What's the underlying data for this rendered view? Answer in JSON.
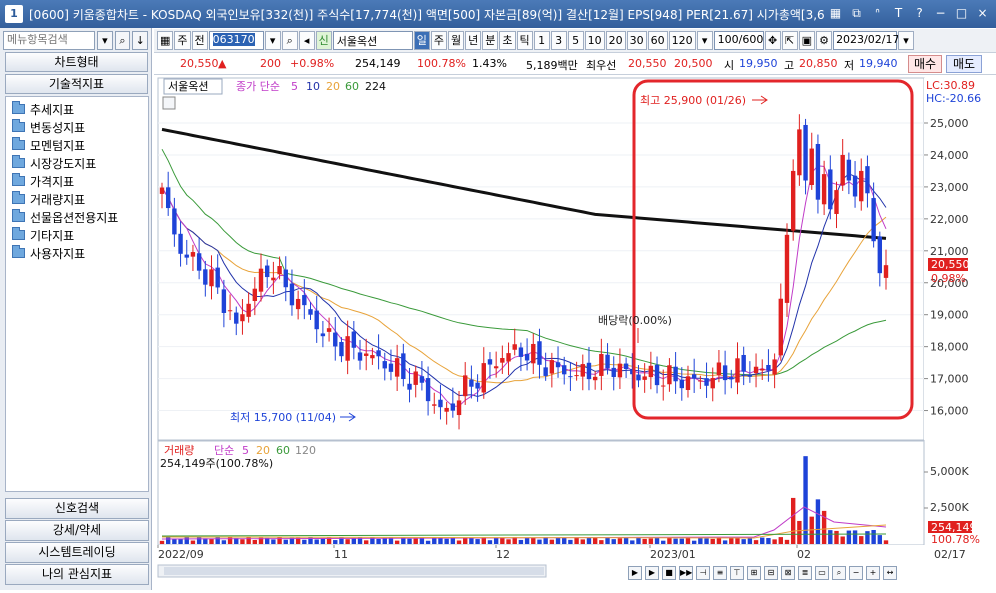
{
  "window": {
    "title": "[0600] 키움종합차트 - KOSDAQ 외국인보유[332(천)] 주식수[17,774(천)] 액면[500] 자본금[89(억)] 결산[12월] EPS[948] PER[21.67] 시가총액[3,6",
    "icon": "1"
  },
  "left": {
    "search_placeholder": "메뉴항목검색",
    "chart_type": "차트형태",
    "indicators_title": "기술적지표",
    "tree": [
      "추세지표",
      "변동성지표",
      "모멘텀지표",
      "시장강도지표",
      "가격지표",
      "거래량지표",
      "선물옵션전용지표",
      "기타지표",
      "사용자지표"
    ],
    "bottom": [
      "신호검색",
      "강세/약세",
      "시스템트레이딩",
      "나의 관심지표"
    ]
  },
  "toolbar": {
    "code": "063170",
    "stock_name": "서울옥션",
    "stock_badge": "신",
    "periods": [
      "일",
      "주",
      "월",
      "년",
      "분",
      "초",
      "틱"
    ],
    "nums": [
      "1",
      "3",
      "5",
      "10",
      "20",
      "30",
      "60",
      "120"
    ],
    "zoom": "100/600",
    "date": "2023/02/17",
    "t1": "주",
    "t2": "전"
  },
  "info": {
    "price": "20,550",
    "arrow": "▲",
    "change": "200",
    "pct": "+0.98%",
    "volume": "254,149",
    "vol_ratio": "100.78%",
    "turnover": "1.43%",
    "amount": "5,189백만",
    "best_label": "최우선",
    "best_ask": "20,550",
    "best_bid": "20,500",
    "open_label": "시",
    "open": "19,950",
    "high_label": "고",
    "high": "20,850",
    "low_label": "저",
    "low": "19,940",
    "buy": "매수",
    "sell": "매도"
  },
  "chart": {
    "stock_legend": "서울옥션",
    "ma_legend": [
      "종가 단순",
      "5",
      "10",
      "20",
      "60",
      "224"
    ],
    "lc": "LC:30.89",
    "hc": "HC:-20.66",
    "high_ann": "최고 25,900 (01/26)",
    "low_ann": "최저 15,700 (11/04)",
    "div_ann": "배당락(0.00%)",
    "price_badge": "20,550",
    "pct_badge": "0.98%",
    "y_ticks": [
      "25,000",
      "24,000",
      "23,000",
      "22,000",
      "21,000",
      "20,000",
      "19,000",
      "18,000",
      "17,000",
      "16,000"
    ],
    "vol_legend": [
      "거래량",
      "단순",
      "5",
      "20",
      "60",
      "120"
    ],
    "vol_info": "254,149주(100.78%)",
    "vol_ticks": [
      "5,000K",
      "2,500K"
    ],
    "vol_badge": "254,149",
    "vol_pct": "100.78%",
    "x_ticks": [
      "2022/09",
      "11",
      "12",
      "2023/01",
      "02"
    ],
    "x_date": "02/17"
  },
  "colors": {
    "up": "#e0201f",
    "down": "#1e43d8",
    "ma5": "#c03cc8",
    "ma10": "#2233aa",
    "ma20": "#e8a33a",
    "ma60": "#3a9a3a",
    "ma224": "#111111",
    "highlight": "#e3262b"
  }
}
